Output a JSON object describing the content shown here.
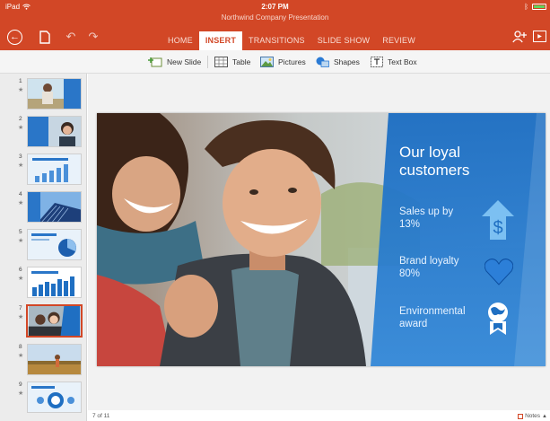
{
  "status": {
    "device": "iPad",
    "time": "2:07 PM"
  },
  "app": {
    "document_title": "Northwind Company Presentation"
  },
  "tabs": [
    {
      "label": "HOME",
      "active": false
    },
    {
      "label": "INSERT",
      "active": true
    },
    {
      "label": "TRANSITIONS",
      "active": false
    },
    {
      "label": "SLIDE SHOW",
      "active": false
    },
    {
      "label": "REVIEW",
      "active": false
    }
  ],
  "ribbon": {
    "new_slide": "New Slide",
    "table": "Table",
    "pictures": "Pictures",
    "shapes": "Shapes",
    "text_box": "Text Box"
  },
  "thumbnails": [
    {
      "number": "1",
      "star": "★"
    },
    {
      "number": "2",
      "star": "★"
    },
    {
      "number": "3",
      "star": "★"
    },
    {
      "number": "4",
      "star": "★"
    },
    {
      "number": "5",
      "star": "★"
    },
    {
      "number": "6",
      "star": "★"
    },
    {
      "number": "7",
      "star": "★",
      "selected": true
    },
    {
      "number": "8",
      "star": "★"
    },
    {
      "number": "9",
      "star": "★"
    }
  ],
  "slide": {
    "headline_line1": "Our loyal",
    "headline_line2": "customers",
    "stat1_line1": "Sales up by",
    "stat1_line2": "13%",
    "stat2_line1": "Brand loyalty",
    "stat2_line2": "80%",
    "stat3_line1": "Environmental",
    "stat3_line2": "award"
  },
  "footer": {
    "slide_count": "7 of 11",
    "notes_label": "Notes"
  },
  "colors": {
    "accent": "#d24726",
    "slide_panel": "#1f6fc2"
  },
  "icons": [
    "wifi-icon",
    "bluetooth-icon",
    "battery-icon",
    "back-icon",
    "file-icon",
    "undo-icon",
    "redo-icon",
    "share-person-icon",
    "present-icon",
    "new-slide-icon",
    "table-icon",
    "pictures-icon",
    "shapes-icon",
    "text-box-icon",
    "dollar-arrow-icon",
    "heart-icon",
    "award-globe-icon",
    "notes-icon"
  ]
}
